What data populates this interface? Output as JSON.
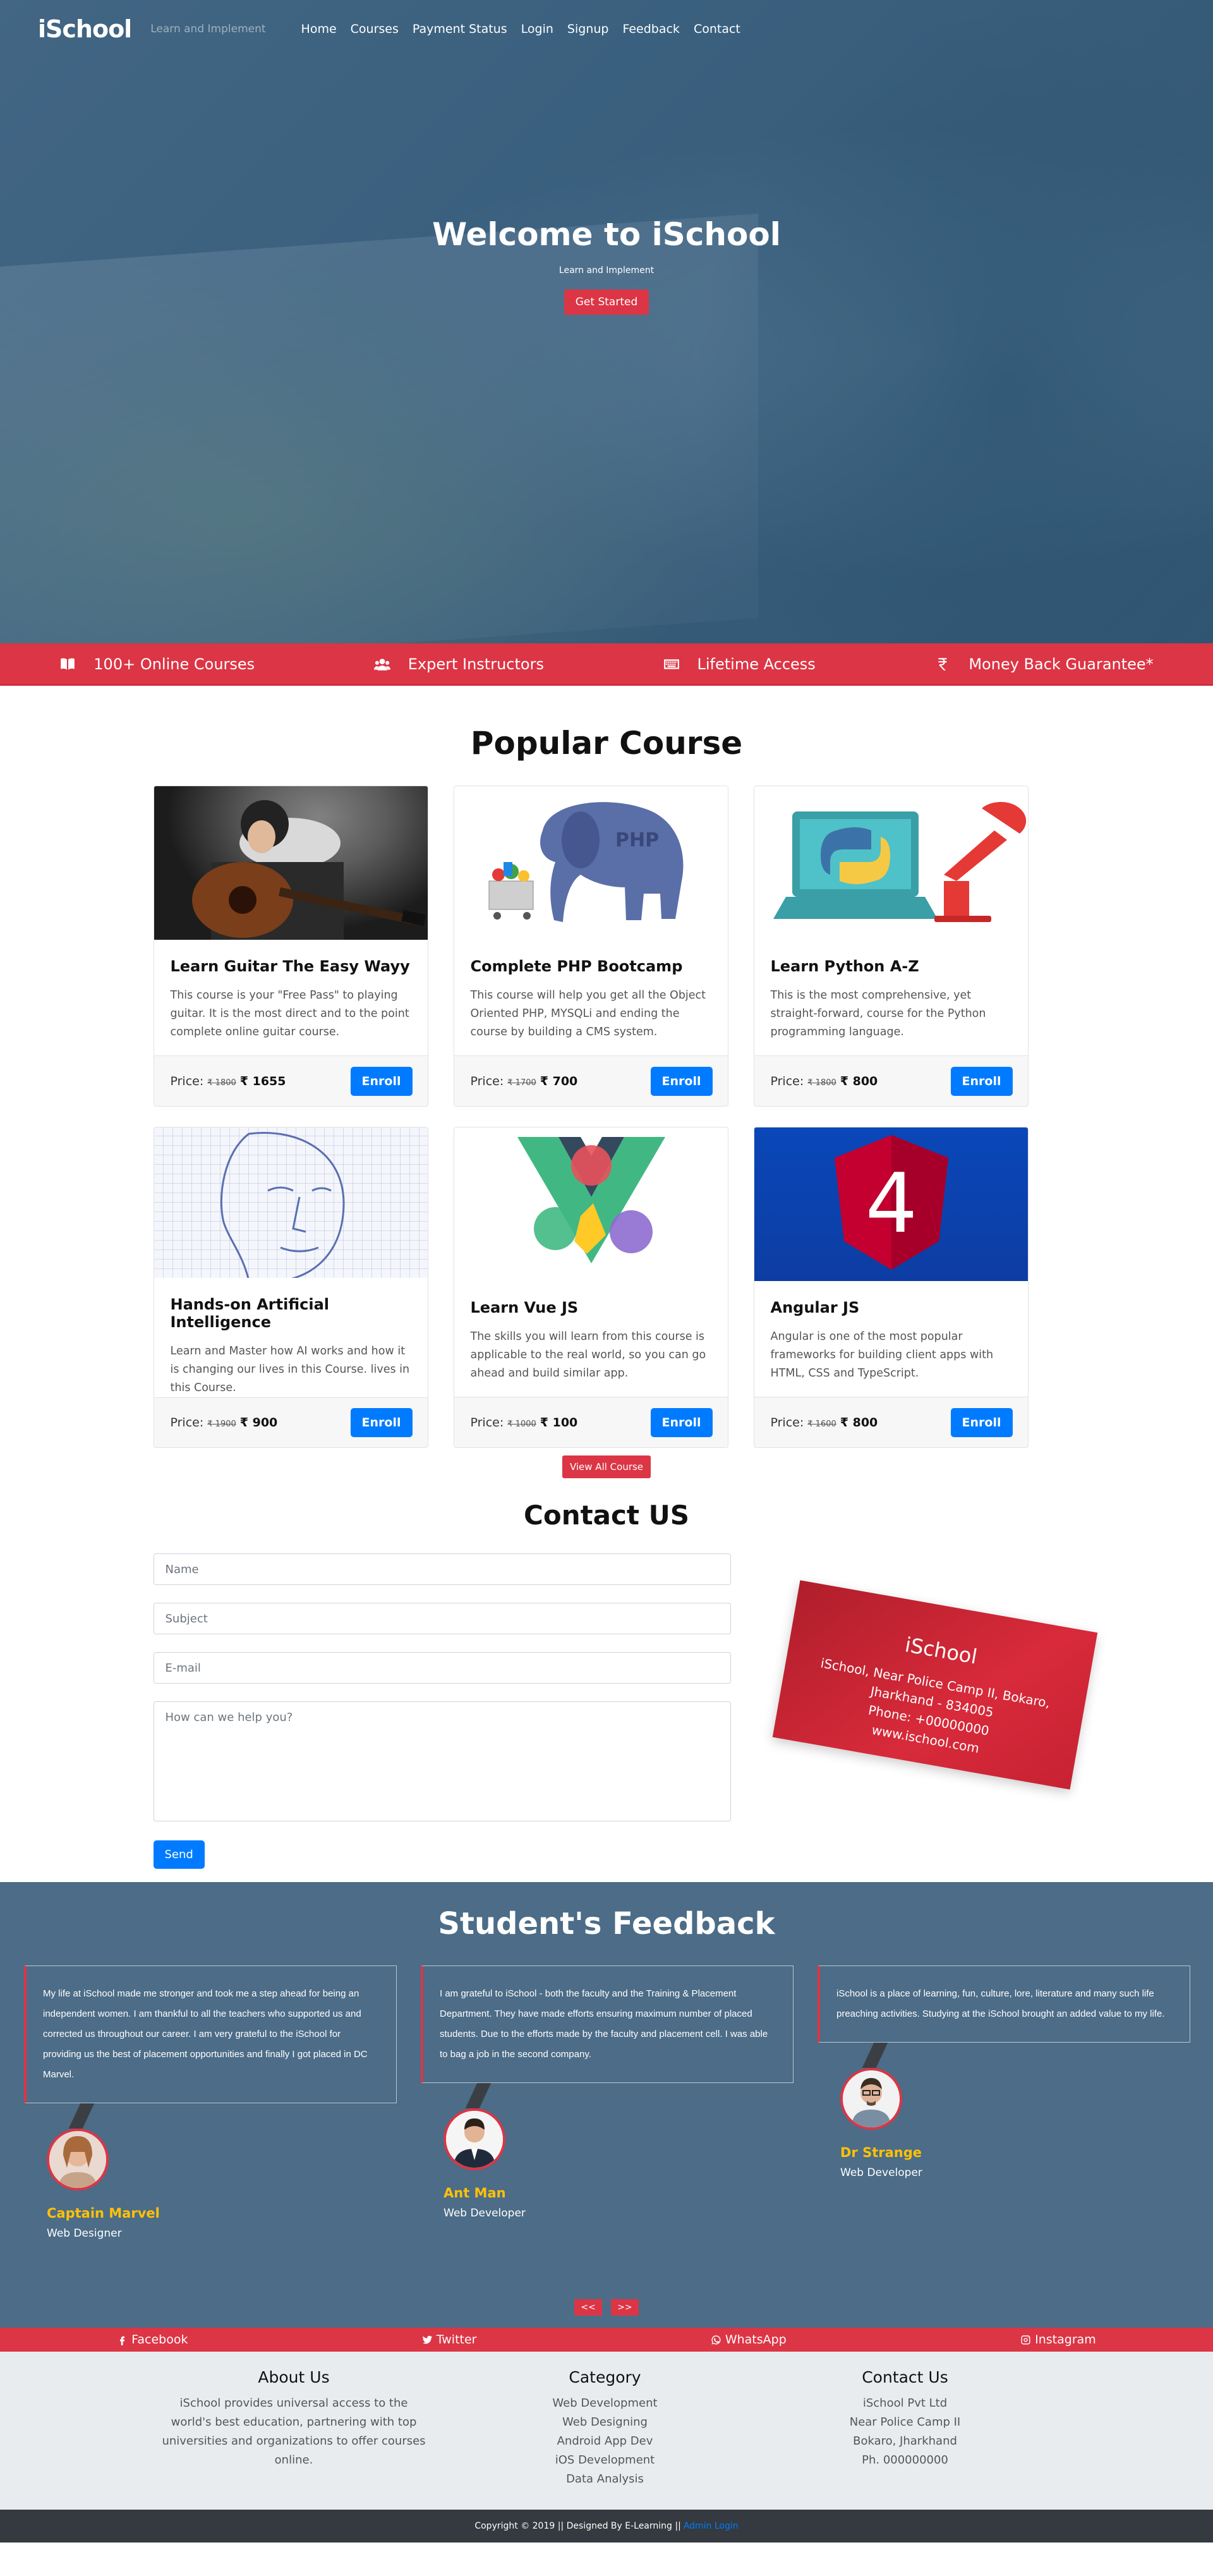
{
  "nav": {
    "brand": "iSchool",
    "tagline": "Learn and Implement",
    "links": [
      "Home",
      "Courses",
      "Payment Status",
      "Login",
      "Signup",
      "Feedback",
      "Contact"
    ]
  },
  "hero": {
    "title": "Welcome to iSchool",
    "subtitle": "Learn and Implement",
    "cta": "Get Started"
  },
  "features": [
    {
      "icon": "book-open-icon",
      "label": "100+ Online Courses"
    },
    {
      "icon": "users-icon",
      "label": "Expert Instructors"
    },
    {
      "icon": "keyboard-icon",
      "label": "Lifetime Access"
    },
    {
      "icon": "rupee-icon",
      "label": "Money Back Guarantee*"
    }
  ],
  "courses": {
    "title": "Popular Course",
    "items": [
      {
        "title": "Learn Guitar The Easy Wayy",
        "desc": "This course is your \"Free Pass\" to playing guitar. It is the most direct and to the point complete online guitar course.",
        "price_label": "Price:",
        "old_price": "₹ 1800",
        "price": "₹ 1655",
        "enroll": "Enroll"
      },
      {
        "title": "Complete PHP Bootcamp",
        "desc": "This course will help you get all the Object Oriented PHP, MYSQLi and ending the course by building a CMS system.",
        "price_label": "Price:",
        "old_price": "₹ 1700",
        "price": "₹ 700",
        "enroll": "Enroll"
      },
      {
        "title": "Learn Python A-Z",
        "desc": "This is the most comprehensive, yet straight-forward, course for the Python programming language.",
        "price_label": "Price:",
        "old_price": "₹ 1800",
        "price": "₹ 800",
        "enroll": "Enroll"
      },
      {
        "title": "Hands-on Artificial Intelligence",
        "desc": "Learn and Master how AI works and how it is changing our lives in this Course. lives in this Course.",
        "price_label": "Price:",
        "old_price": "₹ 1900",
        "price": "₹ 900",
        "enroll": "Enroll"
      },
      {
        "title": "Learn Vue JS",
        "desc": "The skills you will learn from this course is applicable to the real world, so you can go ahead and build similar app.",
        "price_label": "Price:",
        "old_price": "₹ 1000",
        "price": "₹ 100",
        "enroll": "Enroll"
      },
      {
        "title": "Angular JS",
        "desc": "Angular is one of the most popular frameworks for building client apps with HTML, CSS and TypeScript.",
        "price_label": "Price:",
        "old_price": "₹ 1600",
        "price": "₹ 800",
        "enroll": "Enroll"
      }
    ],
    "view_all": "View All Course",
    "php_logo_text": "PHP",
    "angular_number": "4"
  },
  "contact": {
    "title": "Contact US",
    "name_placeholder": "Name",
    "subject_placeholder": "Subject",
    "email_placeholder": "E-mail",
    "message_placeholder": "How can we help you?",
    "send": "Send",
    "card_title": "iSchool",
    "card_lines": [
      "iSchool, Near Police Camp II, Bokaro,",
      "Jharkhand - 834005",
      "Phone: +00000000",
      "www.ischool.com"
    ]
  },
  "feedback": {
    "title": "Student's Feedback",
    "items": [
      {
        "text": "My life at iSchool made me stronger and took me a step ahead for being an independent women. I am thankful to all the teachers who supported us and corrected us throughout our career. I am very grateful to the iSchool for providing us the best of placement opportunities and finally I got placed in DC Marvel.",
        "name": "Captain Marvel",
        "role": "Web Designer"
      },
      {
        "text": "I am grateful to iSchool - both the faculty and the Training & Placement Department. They have made efforts ensuring maximum number of placed students. Due to the efforts made by the faculty and placement cell. I was able to bag a job in the second company.",
        "name": "Ant Man",
        "role": "Web Developer"
      },
      {
        "text": "iSchool is a place of learning, fun, culture, lore, literature and many such life preaching activities. Studying at the iSchool brought an added value to my life.",
        "name": "Dr Strange",
        "role": "Web Developer"
      }
    ],
    "prev": "<<",
    "next": ">>"
  },
  "social": [
    "Facebook",
    "Twitter",
    "WhatsApp",
    "Instagram"
  ],
  "footer": {
    "about_title": "About Us",
    "about_text": "iSchool provides universal access to the world's best education, partnering with top universities and organizations to offer courses online.",
    "category_title": "Category",
    "categories": [
      "Web Development",
      "Web Designing",
      "Android App Dev",
      "iOS Development",
      "Data Analysis"
    ],
    "contact_title": "Contact Us",
    "contact_lines": [
      "iSchool Pvt Ltd",
      "Near Police Camp II",
      "Bokaro, Jharkhand",
      "Ph. 000000000"
    ],
    "copyright": "Copyright © 2019 || Designed By E-Learning ||",
    "admin_link": "Admin Login"
  },
  "colors": {
    "accent_red": "#dc3545",
    "primary_blue": "#007bff",
    "feedback_bg": "#4c6c87",
    "name_gold": "#ffc107"
  }
}
